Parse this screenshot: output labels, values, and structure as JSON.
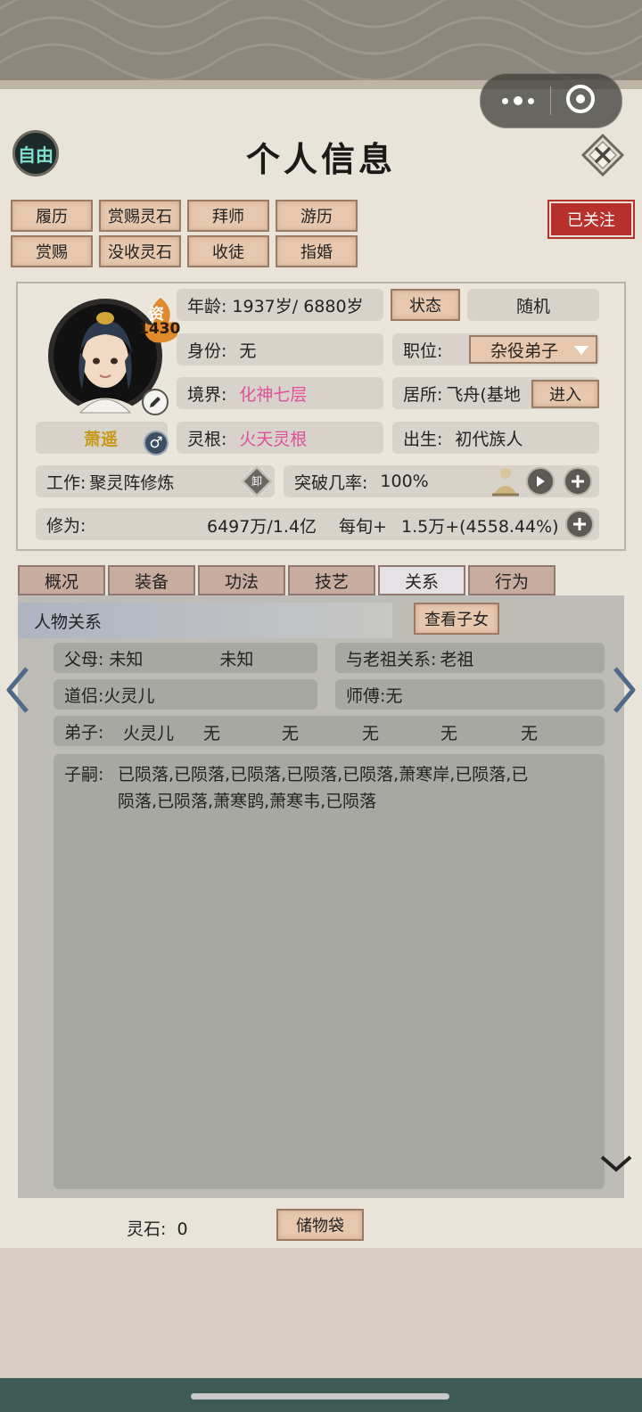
{
  "header": {
    "free_label": "自由",
    "title": "个人信息"
  },
  "actions": {
    "row1": [
      "履历",
      "赏赐灵石",
      "拜师",
      "游历"
    ],
    "row2": [
      "赏赐",
      "没收灵石",
      "收徒",
      "指婚"
    ],
    "follow": "已关注"
  },
  "profile": {
    "aptitude_label": "资",
    "aptitude_value": "1430",
    "name": "萧遥",
    "gender_symbol": "♂",
    "age_label": "年龄:",
    "age_value": "1937岁/ 6880岁",
    "status_button": "状态",
    "random_button": "随机",
    "identity_label": "身份:",
    "identity_value": "无",
    "position_label": "职位:",
    "position_value": "杂役弟子",
    "realm_label": "境界:",
    "realm_value": "化神七层",
    "residence_label": "居所:",
    "residence_value": "飞舟(基地",
    "enter_button": "进入",
    "root_label": "灵根:",
    "root_value": "火天灵根",
    "birth_label": "出生:",
    "birth_value": "初代族人",
    "work_label": "工作:",
    "work_value": "聚灵阵修炼",
    "unload_label": "卸",
    "breakthrough_label": "突破几率:",
    "breakthrough_value": "100%",
    "cultivation_label": "修为:",
    "cultivation_value": "6497万/1.4亿",
    "per_label": "每旬+",
    "per_value": "1.5万+(4558.44%)"
  },
  "tabs": [
    "概况",
    "装备",
    "功法",
    "技艺",
    "关系",
    "行为"
  ],
  "active_tab": "关系",
  "relations": {
    "section_title": "人物关系",
    "view_children_button": "查看子女",
    "parents_label": "父母:",
    "parents_values": [
      "未知",
      "未知"
    ],
    "ancestor_label": "与老祖关系:",
    "ancestor_value": "老祖",
    "partner_label": "道侣:",
    "partner_value": "火灵儿",
    "master_label": "师傅:",
    "master_value": "无",
    "disciples_label": "弟子:",
    "disciples_values": [
      "火灵儿",
      "无",
      "无",
      "无",
      "无",
      "无"
    ],
    "children_label": "子嗣:",
    "children_line1": "已陨落,已陨落,已陨落,已陨落,已陨落,萧寒岸,已陨落,已",
    "children_line2": "陨落,已陨落,萧寒鹍,萧寒韦,已陨落"
  },
  "footer": {
    "spirit_stone_label": "灵石:",
    "spirit_stone_value": "0",
    "storage_button": "储物袋"
  },
  "colors": {
    "accent_pink": "#e0509a",
    "follow_red": "#b8302b",
    "tab_active": "#e6e1e4"
  }
}
